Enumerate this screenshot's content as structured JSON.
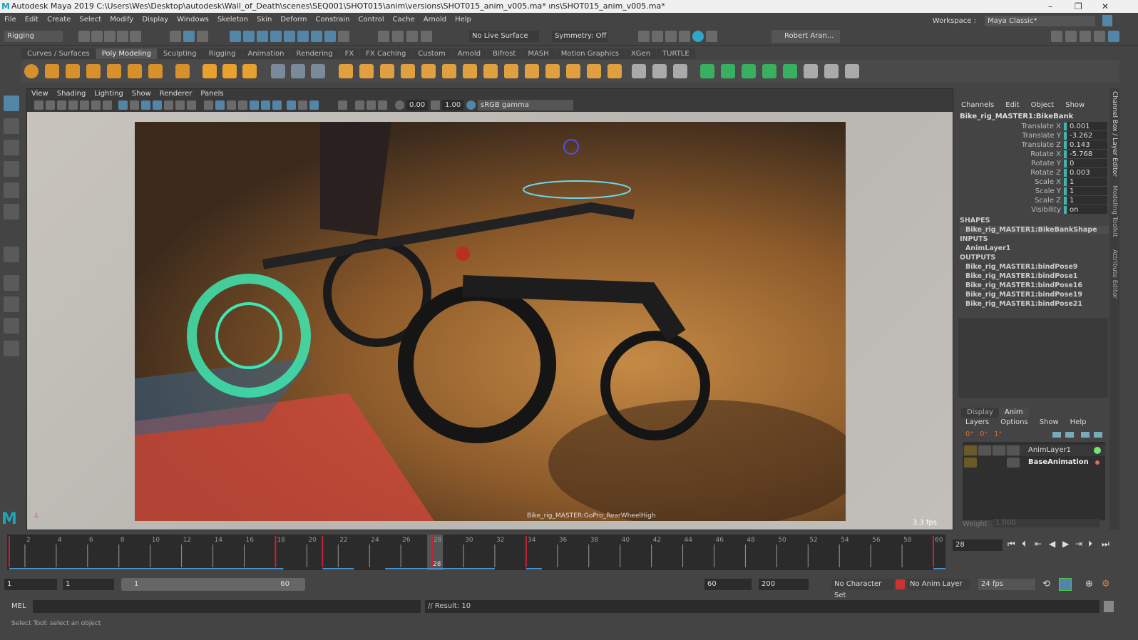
{
  "titlebar": {
    "title": "Autodesk Maya 2019  C:\\Users\\Wes\\Desktop\\autodesk\\Wall_of_Death\\scenes\\SEQ001\\SHOT015\\anim\\versions\\SHOT015_anim_v005.ma*  ıns\\SHOT015_anim_v005.ma*"
  },
  "menubar": [
    "File",
    "Edit",
    "Create",
    "Select",
    "Modify",
    "Display",
    "Windows",
    "Skeleton",
    "Skin",
    "Deform",
    "Constrain",
    "Control",
    "Cache",
    "Arnold",
    "Help"
  ],
  "workspace": {
    "label": "Workspace :",
    "value": "Maya Classic*"
  },
  "statusline": {
    "menuset": "Rigging",
    "live_surface": "No Live Surface",
    "symmetry": "Symmetry: Off",
    "user": "Robert Aran..."
  },
  "shelf_tabs": [
    "Curves / Surfaces",
    "Poly Modeling",
    "Sculpting",
    "Rigging",
    "Animation",
    "Rendering",
    "FX",
    "FX Caching",
    "Custom",
    "Arnold",
    "Bifrost",
    "MASH",
    "Motion Graphics",
    "XGen",
    "TURTLE"
  ],
  "shelf_active": "Poly Modeling",
  "viewport": {
    "menu": [
      "View",
      "Shading",
      "Lighting",
      "Show",
      "Renderer",
      "Panels"
    ],
    "exposure": "0.00",
    "gamma": "1.00",
    "colorspace": "sRGB gamma",
    "camera": "Bike_rig_MASTER:GoPro_RearWheelHigh",
    "fps": "3.3 fps"
  },
  "channelbox": {
    "menu": [
      "Channels",
      "Edit",
      "Object",
      "Show"
    ],
    "object": "Bike_rig_MASTER1:BikeBank",
    "attrs": [
      {
        "name": "Translate X",
        "value": "0.001"
      },
      {
        "name": "Translate Y",
        "value": "-3.262"
      },
      {
        "name": "Translate Z",
        "value": "0.143"
      },
      {
        "name": "Rotate X",
        "value": "-5.768"
      },
      {
        "name": "Rotate Y",
        "value": "0"
      },
      {
        "name": "Rotate Z",
        "value": "0.003"
      },
      {
        "name": "Scale X",
        "value": "1"
      },
      {
        "name": "Scale Y",
        "value": "1"
      },
      {
        "name": "Scale Z",
        "value": "1"
      },
      {
        "name": "Visibility",
        "value": "on"
      }
    ],
    "shapes_label": "SHAPES",
    "shape": "Bike_rig_MASTER1:BikeBankShape",
    "inputs_label": "INPUTS",
    "input": "AnimLayer1",
    "outputs_label": "OUTPUTS",
    "outputs": [
      "Bike_rig_MASTER1:bindPose9",
      "Bike_rig_MASTER1:bindPose1",
      "Bike_rig_MASTER1:bindPose16",
      "Bike_rig_MASTER1:bindPose19",
      "Bike_rig_MASTER1:bindPose21"
    ]
  },
  "side_tabs": [
    "Channel Box / Layer Editor",
    "Modeling Toolkit",
    "Attribute Editor"
  ],
  "layer_editor": {
    "tabs": [
      "Display",
      "Anim"
    ],
    "active_tab": "Anim",
    "menu": [
      "Layers",
      "Options",
      "Show",
      "Help"
    ],
    "layers": [
      {
        "name": "AnimLayer1",
        "color": "#6ee86e"
      },
      {
        "name": "BaseAnimation",
        "color": "#e06a6a"
      }
    ],
    "weight_label": "Weight",
    "weight": "1.000"
  },
  "timeline": {
    "start": 1,
    "end": 60,
    "current": 28,
    "current_label": "28",
    "keys": [
      1,
      18,
      21,
      28,
      34,
      60
    ]
  },
  "current_frame": "28",
  "range": {
    "start": "1",
    "playback_start": "1",
    "slider_start": "1",
    "slider_end": "60",
    "playback_end": "60",
    "end": "200",
    "character_set": "No Character Set",
    "anim_layer": "No Anim Layer",
    "fps": "24 fps"
  },
  "cmdline": {
    "label": "MEL",
    "result": "// Result: 10"
  },
  "helpline": "Select Tool: select an object"
}
